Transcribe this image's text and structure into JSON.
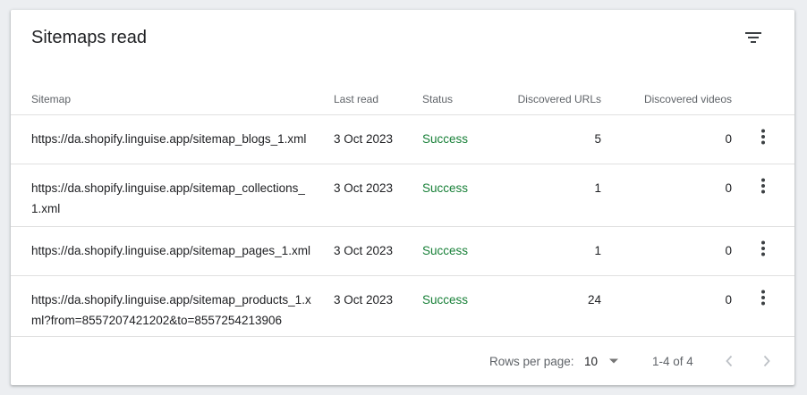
{
  "card": {
    "title": "Sitemaps read"
  },
  "table": {
    "columns": {
      "sitemap": "Sitemap",
      "last_read": "Last read",
      "status": "Status",
      "discovered_urls": "Discovered URLs",
      "discovered_videos": "Discovered videos"
    },
    "rows": [
      {
        "sitemap": "https://da.shopify.linguise.app/sitemap_blogs_1.xml",
        "last_read": "3 Oct 2023",
        "status": "Success",
        "discovered_urls": "5",
        "discovered_videos": "0"
      },
      {
        "sitemap": "https://da.shopify.linguise.app/sitemap_collections_1.xml",
        "last_read": "3 Oct 2023",
        "status": "Success",
        "discovered_urls": "1",
        "discovered_videos": "0"
      },
      {
        "sitemap": "https://da.shopify.linguise.app/sitemap_pages_1.xml",
        "last_read": "3 Oct 2023",
        "status": "Success",
        "discovered_urls": "1",
        "discovered_videos": "0"
      },
      {
        "sitemap": "https://da.shopify.linguise.app/sitemap_products_1.xml?from=8557207421202&to=8557254213906",
        "last_read": "3 Oct 2023",
        "status": "Success",
        "discovered_urls": "24",
        "discovered_videos": "0"
      }
    ]
  },
  "pagination": {
    "rows_per_page_label": "Rows per page:",
    "rows_per_page_value": "10",
    "range_text": "1-4 of 4"
  },
  "icons": {
    "filter": "filter-icon",
    "more": "more-vert-icon",
    "dropdown": "arrow-drop-down-icon",
    "prev": "chevron-left-icon",
    "next": "chevron-right-icon"
  },
  "colors": {
    "status_success": "#188038",
    "text_primary": "#202124",
    "text_secondary": "#5f6368",
    "divider": "#e0e0e0"
  }
}
